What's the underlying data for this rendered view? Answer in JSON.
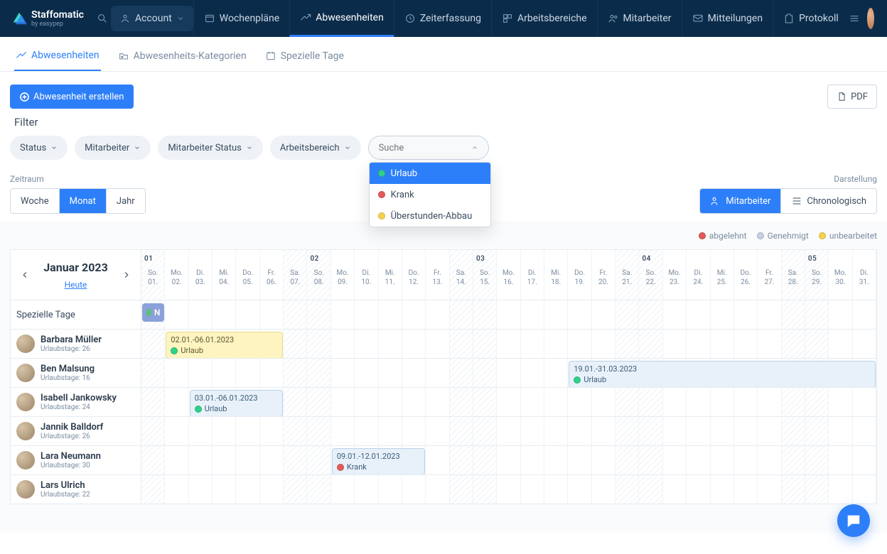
{
  "app": {
    "brand": "Staffomatic",
    "subbrand": "by easypep"
  },
  "topnav": {
    "account": "Account",
    "items": [
      {
        "label": "Wochenpläne",
        "active": false
      },
      {
        "label": "Abwesenheiten",
        "active": true
      },
      {
        "label": "Zeiterfassung",
        "active": false
      },
      {
        "label": "Arbeitsbereiche",
        "active": false
      },
      {
        "label": "Mitarbeiter",
        "active": false
      },
      {
        "label": "Mitteilungen",
        "active": false
      },
      {
        "label": "Protokoll",
        "active": false
      }
    ]
  },
  "subtabs": [
    {
      "label": "Abwesenheiten",
      "active": true
    },
    {
      "label": "Abwesenheits-Kategorien",
      "active": false
    },
    {
      "label": "Spezielle Tage",
      "active": false
    }
  ],
  "buttons": {
    "create": "Abwesenheit erstellen",
    "pdf": "PDF"
  },
  "filter_label": "Filter",
  "filters": {
    "status": "Status",
    "mitarbeiter": "Mitarbeiter",
    "mitarbeiter_status": "Mitarbeiter Status",
    "arbeitsbereich": "Arbeitsbereich",
    "search_placeholder": "Suche",
    "dropdown": [
      {
        "label": "Urlaub",
        "color": "green",
        "selected": true
      },
      {
        "label": "Krank",
        "color": "red",
        "selected": false
      },
      {
        "label": "Überstunden-Abbau",
        "color": "yellow",
        "selected": false
      }
    ]
  },
  "zeitraum": {
    "label": "Zeitraum",
    "options": [
      "Woche",
      "Monat",
      "Jahr"
    ],
    "active": "Monat"
  },
  "darstellung": {
    "label": "Darstellung",
    "options": [
      "Mitarbeiter",
      "Chronologisch"
    ],
    "active": "Mitarbeiter"
  },
  "legend": {
    "abgelehnt": "abgelehnt",
    "genehmigt": "Genehmigt",
    "unbearbeitet": "unbearbeitet"
  },
  "calendar": {
    "month_label": "Januar 2023",
    "today": "Heute",
    "week_markers": {
      "1": "01",
      "8": "02",
      "15": "03",
      "22": "04",
      "29": "05"
    },
    "spezielle_tage_label": "Spezielle Tage",
    "urlaubstage_prefix": "Urlaubstage:",
    "days": [
      [
        "So.",
        "01."
      ],
      [
        "Mo.",
        "02."
      ],
      [
        "Di.",
        "03."
      ],
      [
        "Mi.",
        "04."
      ],
      [
        "Do.",
        "05."
      ],
      [
        "Fr.",
        "06."
      ],
      [
        "Sa.",
        "07."
      ],
      [
        "So.",
        "08."
      ],
      [
        "Mo.",
        "09."
      ],
      [
        "Di.",
        "10."
      ],
      [
        "Mi.",
        "11."
      ],
      [
        "Do.",
        "12."
      ],
      [
        "Fr.",
        "13."
      ],
      [
        "Sa.",
        "14."
      ],
      [
        "So.",
        "15."
      ],
      [
        "Mo.",
        "16."
      ],
      [
        "Di.",
        "17."
      ],
      [
        "Mi.",
        "18."
      ],
      [
        "Do.",
        "19."
      ],
      [
        "Fr.",
        "20."
      ],
      [
        "Sa.",
        "21."
      ],
      [
        "So.",
        "22."
      ],
      [
        "Mo.",
        "23."
      ],
      [
        "Di.",
        "24."
      ],
      [
        "Mi.",
        "25."
      ],
      [
        "Do.",
        "26."
      ],
      [
        "Fr.",
        "27."
      ],
      [
        "Sa.",
        "28."
      ],
      [
        "So.",
        "29."
      ],
      [
        "Mo.",
        "30."
      ],
      [
        "Di.",
        "31."
      ]
    ],
    "special_day": {
      "start": 1,
      "end": 1,
      "short": "N"
    },
    "employees": [
      {
        "name": "Barbara Müller",
        "days": 26,
        "event": {
          "start": 2,
          "end": 6,
          "range": "02.01.-06.01.2023",
          "type": "Urlaub",
          "color": "yellow",
          "dot": "green"
        }
      },
      {
        "name": "Ben Malsung",
        "days": 16,
        "event": {
          "start": 19,
          "end": 31,
          "range": "19.01.-31.03.2023",
          "type": "Urlaub",
          "color": "blue",
          "dot": "green"
        }
      },
      {
        "name": "Isabell Jankowsky",
        "days": 24,
        "event": {
          "start": 3,
          "end": 6,
          "range": "03.01.-06.01.2023",
          "type": "Urlaub",
          "color": "blue",
          "dot": "green"
        }
      },
      {
        "name": "Jannik Balldorf",
        "days": 26,
        "event": null
      },
      {
        "name": "Lara Neumann",
        "days": 30,
        "event": {
          "start": 9,
          "end": 12,
          "range": "09.01.-12.01.2023",
          "type": "Krank",
          "color": "blue",
          "dot": "red"
        }
      },
      {
        "name": "Lars Ulrich",
        "days": 22,
        "event": null
      }
    ]
  }
}
